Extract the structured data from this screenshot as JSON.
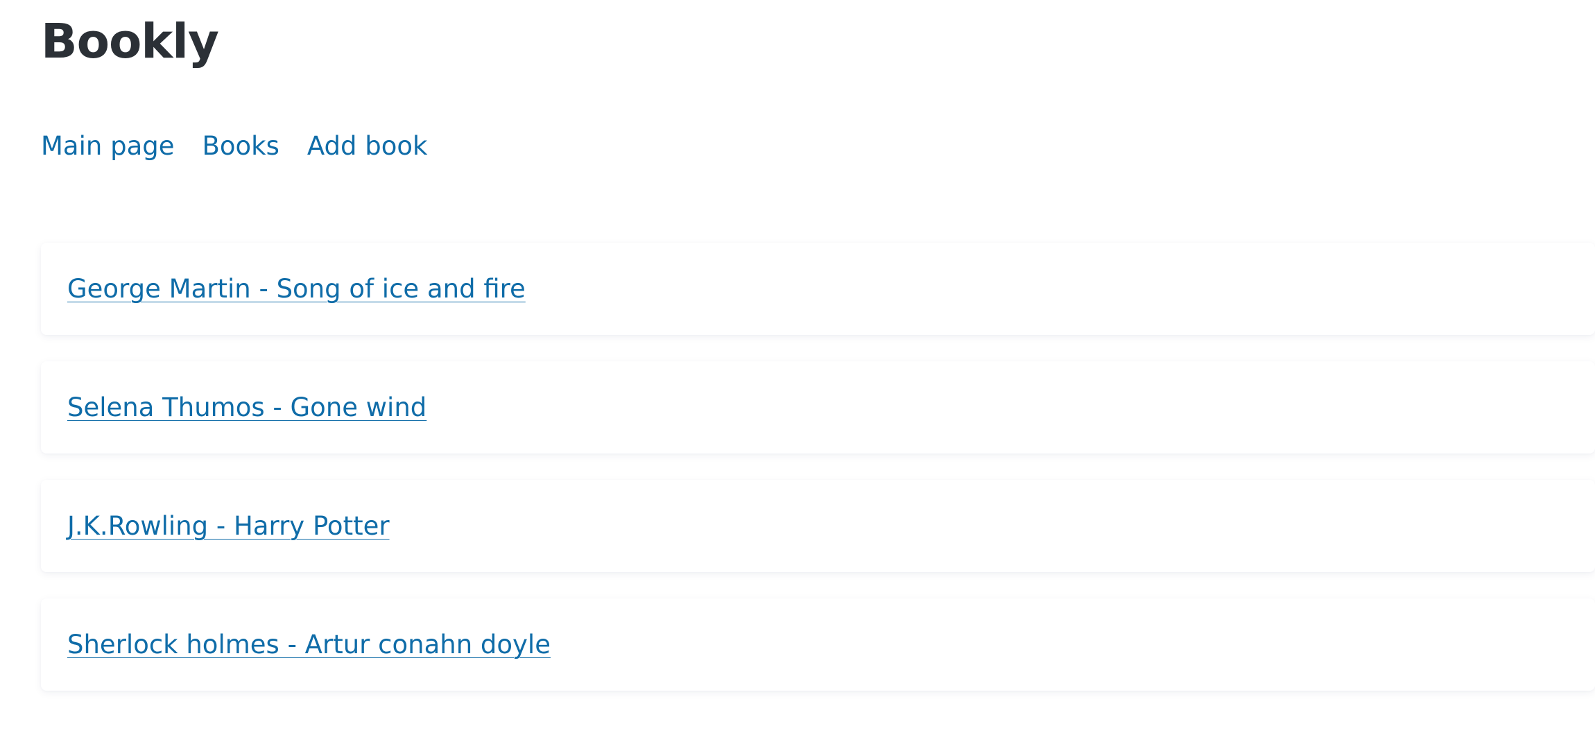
{
  "app": {
    "title": "Bookly"
  },
  "nav": {
    "items": [
      {
        "label": "Main page"
      },
      {
        "label": "Books"
      },
      {
        "label": "Add book"
      }
    ]
  },
  "books": [
    {
      "label": "George Martin - Song of ice and fire"
    },
    {
      "label": "Selena Thumos - Gone wind"
    },
    {
      "label": "J.K.Rowling - Harry Potter"
    },
    {
      "label": "Sherlock holmes - Artur conahn doyle"
    }
  ],
  "colors": {
    "heading": "#2b3036",
    "link": "#0f6ca8",
    "background": "#ffffff"
  }
}
